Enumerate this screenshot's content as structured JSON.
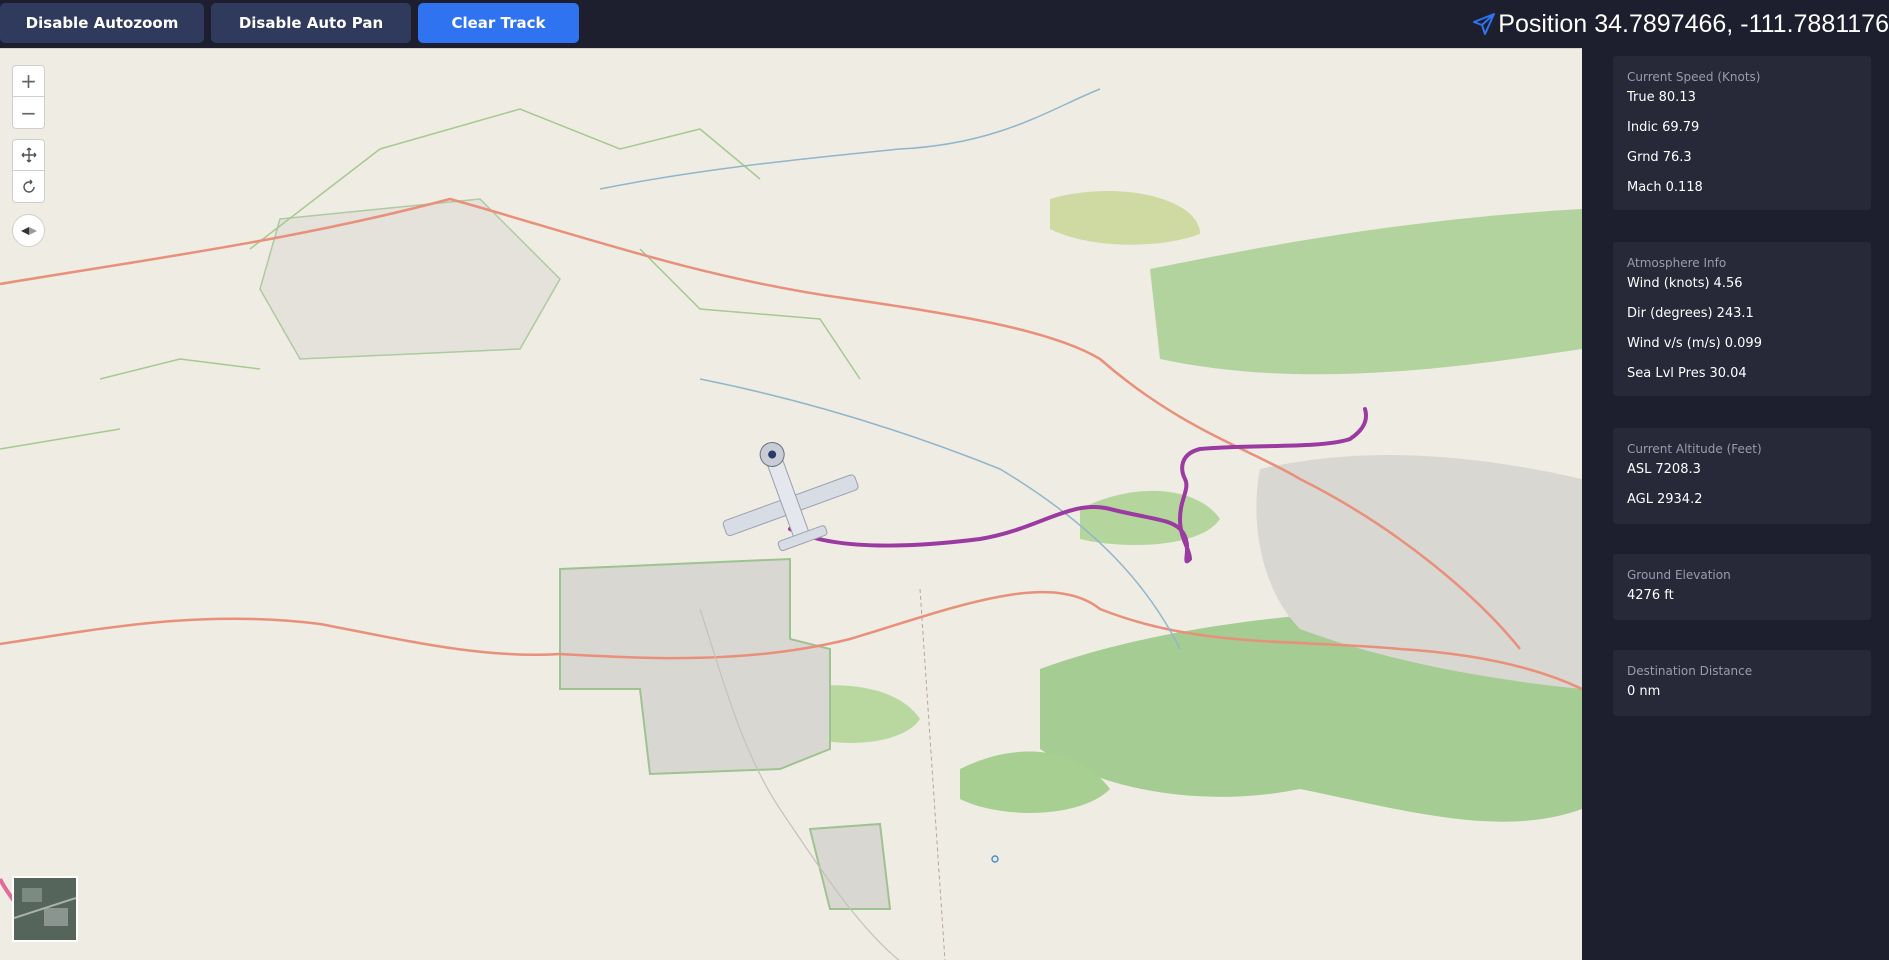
{
  "toolbar": {
    "autozoom_label": "Disable Autozoom",
    "autopan_label": "Disable Auto Pan",
    "clear_track_label": "Clear Track"
  },
  "position": {
    "label": "Position",
    "latitude": "34.7897466,",
    "longitude": "-111.7881176"
  },
  "colors": {
    "background": "#1d1e2e",
    "card": "#272838",
    "button_dark": "#2f3a5c",
    "button_blue": "#2f73f0",
    "track": "#9b3aa0",
    "map_land": "#efece4",
    "map_green": "#9cc98a",
    "map_road": "#e8907a"
  },
  "map": {
    "icons": [
      "zoom-in-icon",
      "zoom-out-icon",
      "move-icon",
      "rotate-icon",
      "compass-icon",
      "plane-model-icon"
    ]
  },
  "speed": {
    "title": "Current Speed (Knots)",
    "true_label": "True",
    "true_value": "80.13",
    "indic_label": "Indic",
    "indic_value": "69.79",
    "grnd_label": "Grnd",
    "grnd_value": "76.3",
    "mach_label": "Mach",
    "mach_value": "0.118"
  },
  "atmosphere": {
    "title": "Atmosphere Info",
    "wind_label": "Wind (knots)",
    "wind_value": "4.56",
    "dir_label": "Dir (degrees)",
    "dir_value": "243.1",
    "windvs_label": "Wind v/s (m/s)",
    "windvs_value": "0.099",
    "pres_label": "Sea Lvl Pres",
    "pres_value": "30.04"
  },
  "altitude": {
    "title": "Current Altitude (Feet)",
    "asl_label": "ASL",
    "asl_value": "7208.3",
    "agl_label": "AGL",
    "agl_value": "2934.2"
  },
  "ground": {
    "title": "Ground Elevation",
    "value": "4276 ft"
  },
  "destination": {
    "title": "Destination Distance",
    "value": "0 nm"
  }
}
